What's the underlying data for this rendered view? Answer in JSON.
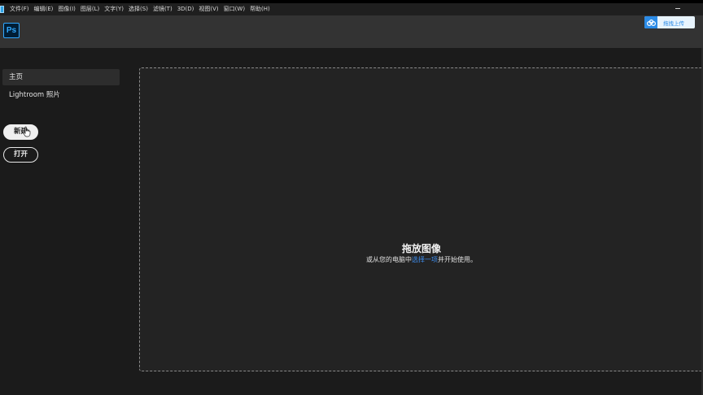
{
  "menu": {
    "items": [
      "文件(F)",
      "编辑(E)",
      "图像(I)",
      "图层(L)",
      "文字(Y)",
      "选择(S)",
      "滤镜(T)",
      "3D(D)",
      "视图(V)",
      "窗口(W)",
      "帮助(H)"
    ]
  },
  "header": {
    "logo_text": "Ps",
    "upload_label": "拖拽上传",
    "upload_icon": "cloud-icon"
  },
  "sidebar": {
    "nav": [
      {
        "label": "主页"
      },
      {
        "label": "Lightroom 照片"
      }
    ],
    "new_button": "新建",
    "open_button": "打开"
  },
  "dropzone": {
    "title": "拖放图像",
    "subtitle_before": "或从您的电脑中",
    "subtitle_link": "选择一项",
    "subtitle_after": "并开始使用。"
  },
  "colors": {
    "accent": "#31a8ff",
    "link": "#3f8ff0",
    "background": "#1b1b1b",
    "header": "#333333"
  }
}
